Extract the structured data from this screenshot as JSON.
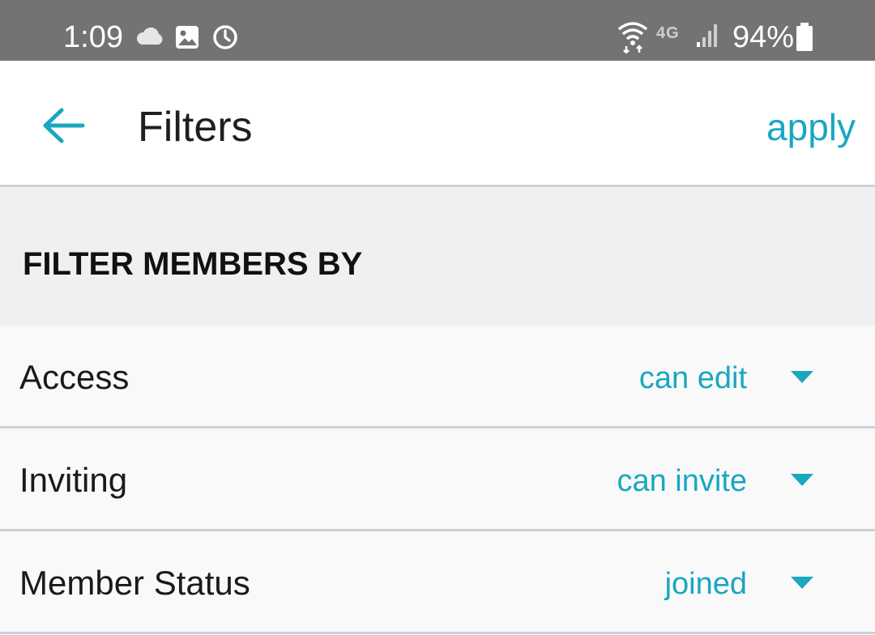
{
  "status_bar": {
    "time": "1:09",
    "battery": "94%",
    "network": "4G",
    "icons": [
      "cloud-icon",
      "image-icon",
      "alarm-icon",
      "wifi-icon",
      "signal-icon",
      "battery-icon"
    ]
  },
  "app_bar": {
    "title": "Filters",
    "apply_label": "apply",
    "back_icon": "back-arrow-icon"
  },
  "section": {
    "title": "FILTER MEMBERS BY"
  },
  "filters": [
    {
      "label": "Access",
      "value": "can edit"
    },
    {
      "label": "Inviting",
      "value": "can invite"
    },
    {
      "label": "Member Status",
      "value": "joined"
    }
  ],
  "colors": {
    "accent": "#1aa7c0",
    "status_bar": "#737373",
    "section_bg": "#eff0f2",
    "divider": "#cbd1d6"
  }
}
